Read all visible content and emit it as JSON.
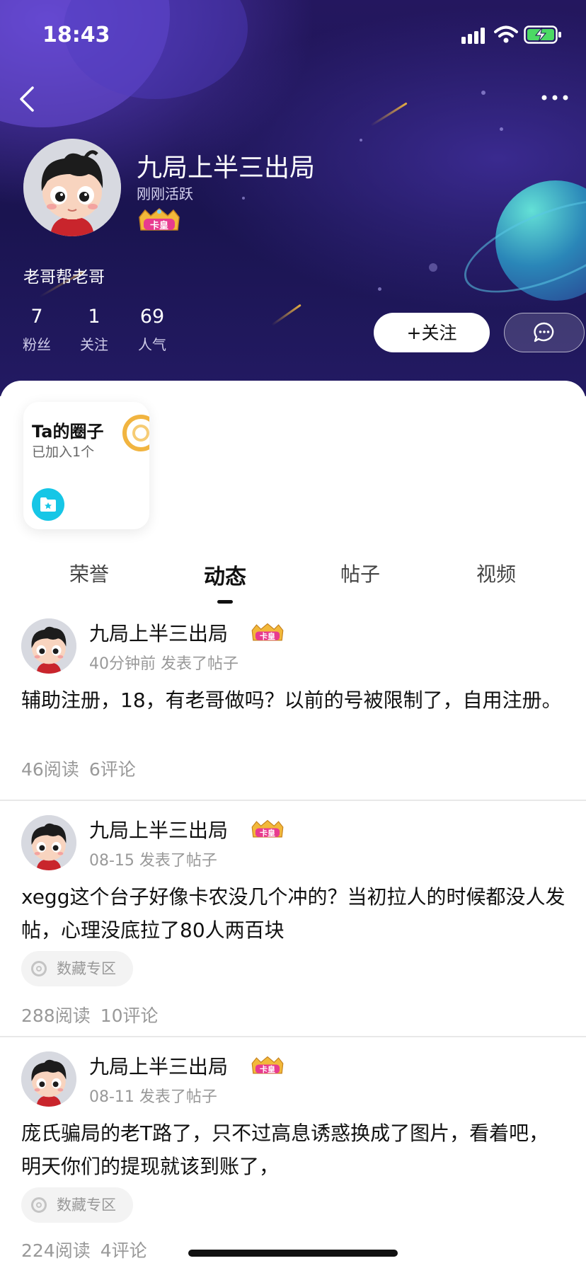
{
  "status_bar": {
    "time": "18:43"
  },
  "profile": {
    "name": "九局上半三出局",
    "active_status": "刚刚活跃",
    "badge": "卡皇",
    "bio": "老哥帮老哥",
    "stats": [
      {
        "value": "7",
        "label": "粉丝"
      },
      {
        "value": "1",
        "label": "关注"
      },
      {
        "value": "69",
        "label": "人气"
      }
    ],
    "follow_label": "+关注"
  },
  "circle_card": {
    "title": "Ta的圈子",
    "subtitle": "已加入1个"
  },
  "tabs": [
    {
      "label": "荣誉"
    },
    {
      "label": "动态",
      "active": true
    },
    {
      "label": "帖子"
    },
    {
      "label": "视频"
    }
  ],
  "posts": [
    {
      "author": "九局上半三出局",
      "badge": "卡皇",
      "meta": "40分钟前 发表了帖子",
      "text": "辅助注册，18，有老哥做吗？以前的号被限制了，自用注册。",
      "reads": "46阅读",
      "comments": "6评论"
    },
    {
      "author": "九局上半三出局",
      "badge": "卡皇",
      "meta": "08-15 发表了帖子",
      "text": "xegg这个台子好像卡农没几个冲的？当初拉人的时候都没人发帖，心理没底拉了80人两百块",
      "tag": "数藏专区",
      "reads": "288阅读",
      "comments": "10评论"
    },
    {
      "author": "九局上半三出局",
      "badge": "卡皇",
      "meta": "08-11 发表了帖子",
      "text": "庞氏骗局的老T路了，只不过高息诱惑换成了图片，看着吧，明天你们的提现就该到账了，",
      "tag": "数藏专区",
      "reads": "224阅读",
      "comments": "4评论"
    }
  ]
}
